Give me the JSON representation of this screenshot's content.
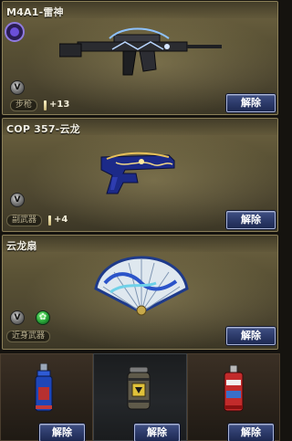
{
  "cards": [
    {
      "title": "M4A1-雷神",
      "weapon_icon": "rifle-icon",
      "badge": "V",
      "type_tag": "步枪",
      "ammo": "+13",
      "button": "解除"
    },
    {
      "title": "COP 357-云龙",
      "weapon_icon": "pistol-icon",
      "badge": "V",
      "type_tag": "副武器",
      "ammo": "+4",
      "button": "解除"
    },
    {
      "title": "云龙扇",
      "weapon_icon": "fan-icon",
      "badge": "V",
      "extra_badge_icon": "green-emblem-icon",
      "type_tag": "近身武器",
      "button": "解除"
    }
  ],
  "grenades": [
    {
      "icon": "blue-grenade-icon",
      "button": "解除"
    },
    {
      "icon": "yellow-grenade-icon",
      "button": "解除"
    },
    {
      "icon": "red-grenade-icon",
      "button": "解除"
    }
  ],
  "colors": {
    "button_bg": "#2b3968",
    "card_bg": "#5a5235",
    "title_text": "#f3f0e4"
  }
}
